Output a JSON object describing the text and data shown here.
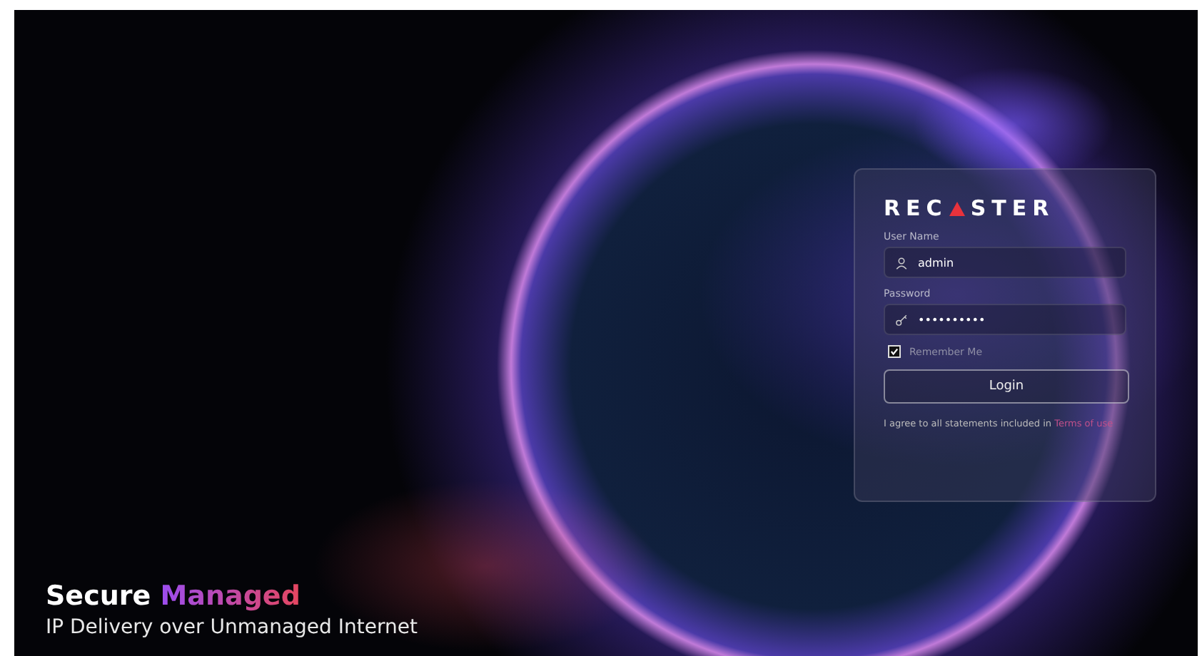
{
  "login_card": {
    "logo": {
      "before": "REC",
      "after": "STER"
    },
    "username": {
      "label": "User Name",
      "value": "admin"
    },
    "password": {
      "label": "Password",
      "value": "••••••••••"
    },
    "remember_me": {
      "label": "Remember Me",
      "checked": true
    },
    "login_button": "Login",
    "terms": {
      "text": "I agree to all statements included in ",
      "link": "Terms of use"
    }
  },
  "tagline": {
    "headline": "Secure",
    "headline_highlight": "Managed",
    "subtitle": "IP Delivery over Unmanaged Internet"
  }
}
